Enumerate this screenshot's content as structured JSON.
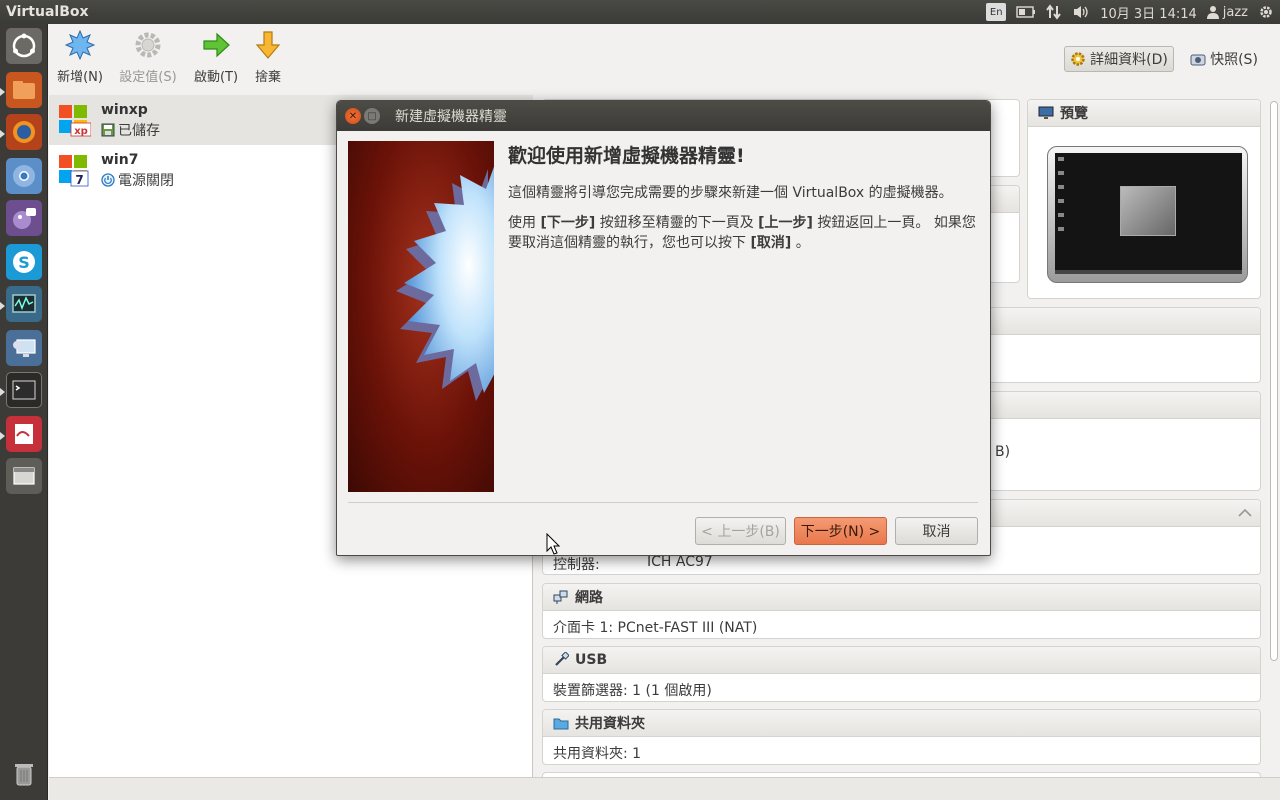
{
  "top_panel": {
    "app_title": "VirtualBox",
    "keyboard_layout": "En",
    "datetime": "10月 3日 14:14",
    "user": "jazz"
  },
  "toolbar": {
    "new_label": "新增(N)",
    "settings_label": "設定值(S)",
    "start_label": "啟動(T)",
    "discard_label": "捨棄",
    "details_label": "詳細資料(D)",
    "snapshots_label": "快照(S)"
  },
  "vm_list": [
    {
      "name": "winxp",
      "state": "已儲存",
      "badge": "xp"
    },
    {
      "name": "win7",
      "state": "電源關閉",
      "badge": "7"
    }
  ],
  "details": {
    "preview_title": "預覽",
    "partial_row": "B)",
    "audio": {
      "key": "控制器:",
      "value": "ICH AC97"
    },
    "network": {
      "title": "網路",
      "line": "介面卡 1: PCnet-FAST III (NAT)"
    },
    "usb": {
      "title": "USB",
      "line": "裝置篩選器: 1 (1 個啟用)"
    },
    "shared": {
      "title": "共用資料夾",
      "line": "共用資料夾: 1"
    }
  },
  "dialog": {
    "title": "新建虛擬機器精靈",
    "heading": "歡迎使用新增虛擬機器精靈!",
    "para1": "這個精靈將引導您完成需要的步驟來新建一個 VirtualBox 的虛擬機器。",
    "para2_a": "使用 ",
    "para2_next": "[下一步]",
    "para2_b": " 按鈕移至精靈的下一頁及 ",
    "para2_back": "[上一步]",
    "para2_c": " 按鈕返回上一頁。 如果您要取消這個精靈的執行，您也可以按下 ",
    "para2_cancel": "[取消]",
    "para2_d": " 。",
    "back_label": "< 上一步(B)",
    "next_label": "下一步(N) >",
    "cancel_label": "取消"
  },
  "colors": {
    "accent_orange": "#e9784c",
    "panel_dark": "#3c3b37",
    "launcher": "#3d3b37"
  }
}
